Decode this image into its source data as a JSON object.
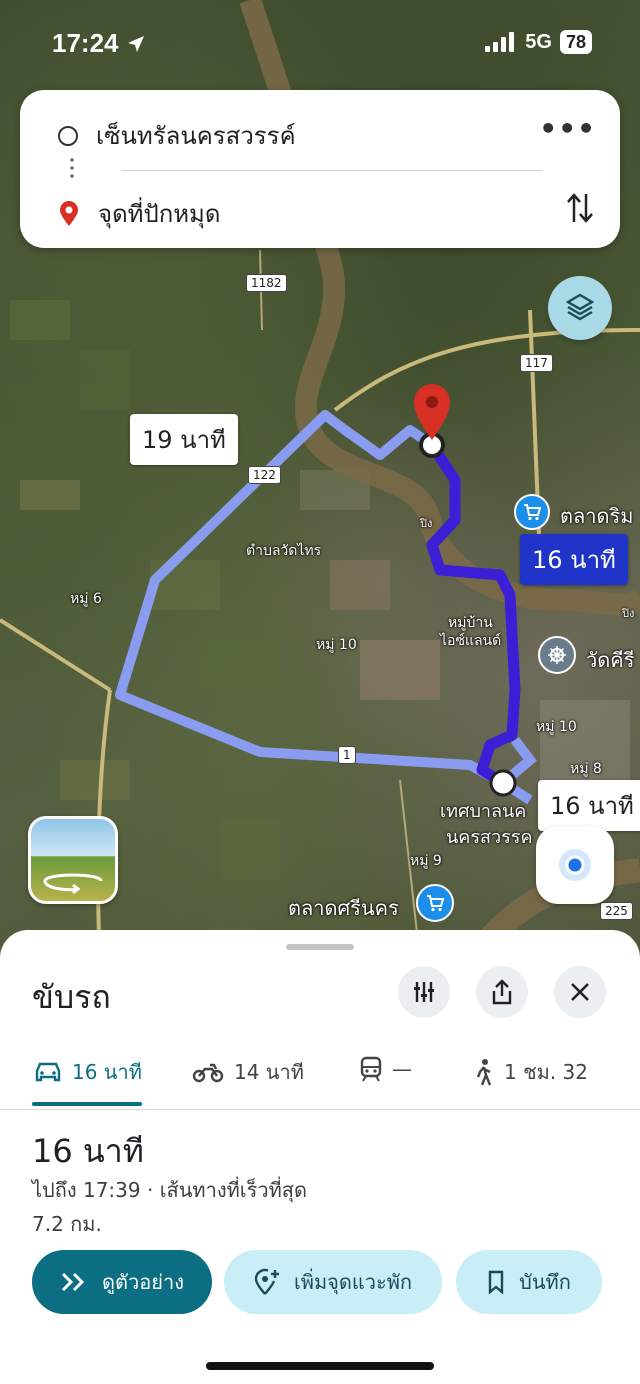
{
  "status_bar": {
    "time": "17:24",
    "network": "5G",
    "battery": "78"
  },
  "search": {
    "origin": "เซ็นทรัลนครสวรรค์",
    "destination": "จุดที่ปักหมุด"
  },
  "map": {
    "labels": {
      "tambon_wat_sai": "ตำบลวัดไทร",
      "moo6": "หมู่ 6",
      "moo10_left": "หมู่ 10",
      "island_village_1": "หมู่บ้าน",
      "island_village_2": "ไอซ์แลนด์",
      "moo10_right": "หมู่ 10",
      "moo8": "หมู่ 8",
      "moo9": "หมู่ 9",
      "municipality_1": "เทศบาลนค",
      "municipality_2": "นครสวรรค",
      "market_rim": "ตลาดริม",
      "wat_khiri": "วัดคีรี",
      "market_srinakorn": "ตลาดศรีนคร",
      "river_ping_1": "ปิง",
      "river_ping_2": "ปิง"
    },
    "road_shields": {
      "r1182": "1182",
      "r117": "117",
      "r122": "122",
      "r1": "1",
      "r225": "225"
    },
    "route_bubbles": {
      "alt_19": "19 นาที",
      "primary_16": "16 นาที",
      "alt_16": "16 นาที"
    }
  },
  "sheet": {
    "title": "ขับรถ",
    "modes": [
      {
        "icon": "car-icon",
        "label": "16 นาที"
      },
      {
        "icon": "motorcycle-icon",
        "label": "14 นาที"
      },
      {
        "icon": "train-icon",
        "label": "—"
      },
      {
        "icon": "walk-icon",
        "label": "1 ชม. 32"
      }
    ],
    "duration": "16 นาที",
    "arrive": "ไปถึง 17:39",
    "route_note": " · เส้นทางที่เร็วที่สุด",
    "distance": "7.2 กม.",
    "buttons": {
      "preview": "ดูตัวอย่าง",
      "add_stop": "เพิ่มจุดแวะพัก",
      "save": "บันทึก"
    }
  },
  "colors": {
    "primary_route": "#3a1fd6",
    "alt_route": "#8a9cf0",
    "accent": "#0b6e82",
    "pin": "#d93025"
  }
}
